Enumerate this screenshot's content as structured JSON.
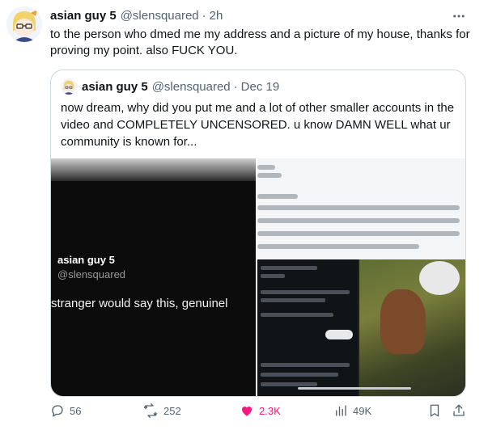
{
  "tweet": {
    "display_name": "asian guy 5",
    "handle": "@slensquared",
    "separator": "·",
    "time": "2h",
    "text": "to the person who dmed me my address and a picture of my house, thanks for proving my point. also FUCK YOU."
  },
  "quote": {
    "display_name": "asian guy 5",
    "handle": "@slensquared",
    "separator": "·",
    "time": "Dec 19",
    "text": "now dream, why did you put me and a lot of other smaller accounts in the video and COMPLETELY UNCENSORED. u know DAMN WELL what ur community is known for...",
    "media": {
      "video_name": "asian guy 5",
      "video_handle": "@slensquared",
      "video_caption": "stranger would say this, genuinel"
    }
  },
  "actions": {
    "replies": "56",
    "reposts": "252",
    "likes": "2.3K",
    "views": "49K"
  },
  "icons": {
    "more": "more-icon",
    "reply": "reply-icon",
    "repost": "repost-icon",
    "like": "heart-icon",
    "views": "views-icon",
    "bookmark": "bookmark-icon",
    "share": "share-icon"
  },
  "colors": {
    "like_active": "#f91880",
    "secondary_text": "#536471",
    "border": "#cfd9de"
  }
}
